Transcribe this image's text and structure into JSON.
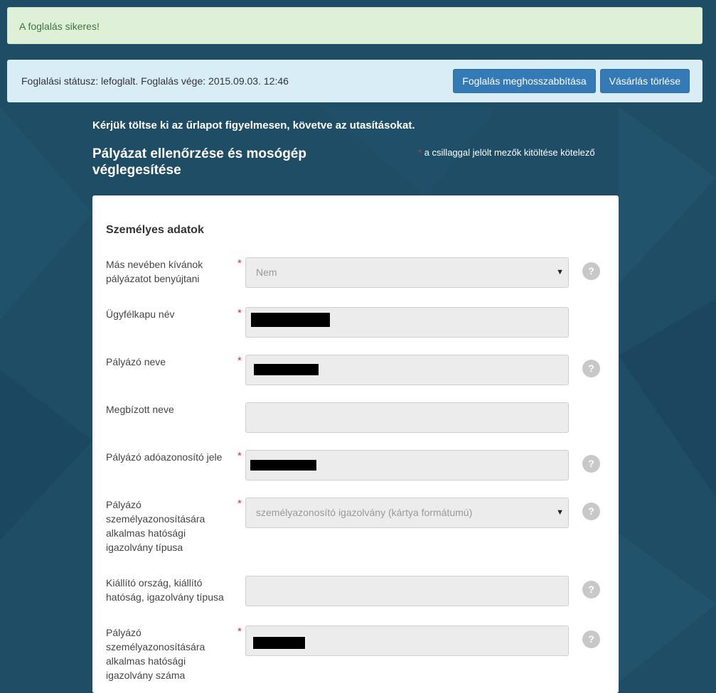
{
  "alerts": {
    "success": "A foglalás sikeres!",
    "status": "Foglalási státusz: lefoglalt. Foglalás vége: 2015.09.03. 12:46",
    "extend_button": "Foglalás meghosszabbítása",
    "cancel_button": "Vásárlás törlése"
  },
  "form": {
    "intro": "Kérjük töltse ki az űrlapot figyelmesen, követve az utasításokat.",
    "title": "Pályázat ellenőrzése és mosógép véglegesítése",
    "required_star": "*",
    "required_note": "a csillaggal jelölt mezők kitöltése kötelező",
    "section": "Személyes adatok",
    "help_glyph": "?",
    "fields": [
      {
        "label": "Más nevében kívánok pályázatot benyújtani",
        "value": "Nem"
      },
      {
        "label": "Ügyfélkapu név",
        "value": ""
      },
      {
        "label": "Pályázó neve",
        "value": ""
      },
      {
        "label": "Megbízott neve",
        "value": ""
      },
      {
        "label": "Pályázó adóazonosító jele",
        "value": ""
      },
      {
        "label": "Pályázó személyazonosítására alkalmas hatósági igazolvány típusa",
        "value": "személyazonosító igazolvány (kártya formátumú)"
      },
      {
        "label": "Kiállító ország, kiállító hatóság, igazolvány típusa",
        "value": ""
      },
      {
        "label": "Pályázó személyazonosítására alkalmas hatósági igazolvány száma",
        "value": ""
      }
    ]
  },
  "icons": {
    "select_caret": "caret-down-icon",
    "help": "help-icon"
  },
  "colors": {
    "background": "#1f4d66",
    "success_bg": "#dff0d8",
    "info_bg": "#d9edf7",
    "button": "#337ab7",
    "required": "#e03030"
  }
}
